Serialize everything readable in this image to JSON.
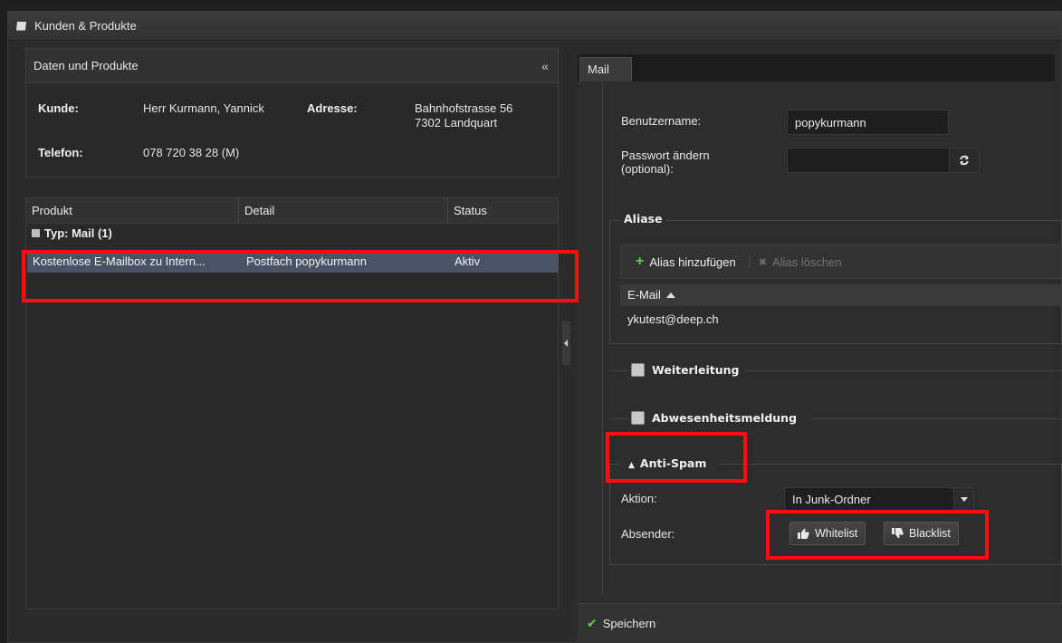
{
  "window": {
    "title": "Kunden & Produkte"
  },
  "info_panel": {
    "title": "Daten und Produkte",
    "collapse_glyph": "«",
    "kunde_label": "Kunde:",
    "kunde_value": "Herr Kurmann, Yannick",
    "adresse_label": "Adresse:",
    "adresse_line1": "Bahnhofstrasse 56",
    "adresse_line2": "7302 Landquart",
    "telefon_label": "Telefon:",
    "telefon_value": "078 720 38 28 (M)"
  },
  "product_grid": {
    "columns": [
      "Produkt",
      "Detail",
      "Status"
    ],
    "group_label": "Typ: Mail (1)",
    "rows": [
      {
        "produkt": "Kostenlose E-Mailbox zu Intern...",
        "detail": "Postfach popykurmann",
        "status": "Aktiv"
      }
    ]
  },
  "mail_tab": {
    "tab_label": "Mail",
    "benutzername_label": "Benutzername:",
    "benutzername_value": "popykurmann",
    "passwort_label_1": "Passwort ändern",
    "passwort_label_2": "(optional):",
    "passwort_value": "",
    "aliase": {
      "legend": "Aliase",
      "add_label": "Alias hinzufügen",
      "delete_label": "Alias löschen",
      "column": "E-Mail",
      "entries": [
        "ykutest@deep.ch"
      ]
    },
    "weiterleitung_label": "Weiterleitung",
    "abwesenheit_label": "Abwesenheitsmeldung",
    "antispam": {
      "legend": "Anti-Spam",
      "aktion_label": "Aktion:",
      "aktion_value": "In Junk-Ordner",
      "absender_label": "Absender:",
      "whitelist_label": "Whitelist",
      "blacklist_label": "Blacklist"
    },
    "save_label": "Speichern"
  },
  "colors": {
    "highlight": "#ff0d0d",
    "selected_row": "#4a5366",
    "accent_green": "#5fcf4a"
  }
}
